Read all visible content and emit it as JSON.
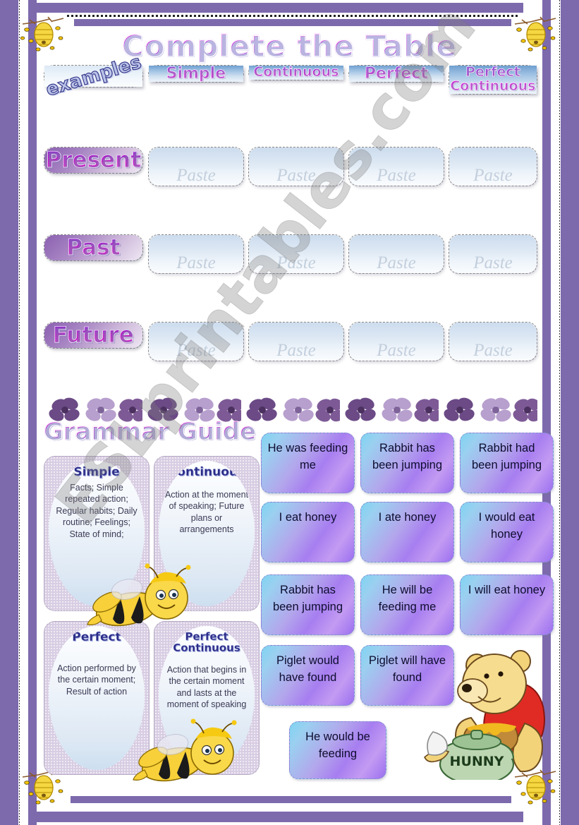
{
  "title": "Complete the Table",
  "watermark": "ESLprintables.com",
  "table": {
    "column_headers": [
      "examples",
      "Simple",
      "Continuous",
      "Perfect",
      "Perfect Continuous"
    ],
    "corner_label": "examples",
    "row_labels": [
      "Present",
      "Past",
      "Future"
    ],
    "placeholder": "Paste",
    "rows": [
      {
        "label": "Present",
        "cells": [
          "Paste",
          "Paste",
          "Paste",
          "Paste"
        ]
      },
      {
        "label": "Past",
        "cells": [
          "Paste",
          "Paste",
          "Paste",
          "Paste"
        ]
      },
      {
        "label": "Future",
        "cells": [
          "Paste",
          "Paste",
          "Paste",
          "Paste"
        ]
      }
    ]
  },
  "grammar_guide": {
    "heading": "Grammar Guide",
    "cards": [
      {
        "title": "Simple",
        "body": "Facts;\nSimple repeated action;\nRegular habits;\nDaily routine;\nFeelings;\nState of mind;"
      },
      {
        "title": "Continuous",
        "body": "Action at the moment of speaking;\nFuture plans or arrangements"
      },
      {
        "title": "Perfect",
        "body": "Action performed by the certain moment;\nResult of action"
      },
      {
        "title": "Perfect Continuous",
        "body": "Action that begins in the certain moment and lasts at the moment of speaking"
      }
    ]
  },
  "sentence_cards": [
    "He was feeding me",
    "Rabbit has been jumping",
    "Rabbit had been jumping",
    "I eat honey",
    "I ate honey",
    "I would eat honey",
    "Rabbit has been jumping",
    "He will be feeding me",
    "I will eat honey",
    "Piglet would have found",
    "Piglet will have found",
    "He would be feeding"
  ],
  "decorations": {
    "honey_pot_label": "HUNNY",
    "corner_icon": "beehive-icon",
    "mascot": "bee-icon",
    "character": "winnie-the-pooh-icon",
    "border_motif": "flower-icon"
  },
  "colors": {
    "frame_purple": "#7d6aad",
    "title_magenta": "#d60ad6",
    "header_blue": "#9dc0e2",
    "card_purple": "#a77ef0",
    "row_label_purple": "#8a5fb0"
  }
}
